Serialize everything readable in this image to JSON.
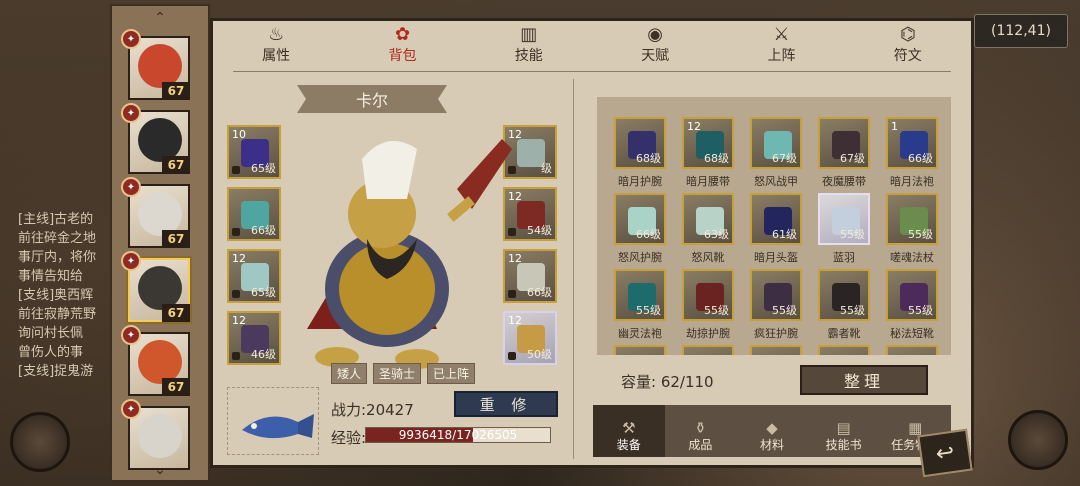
{
  "coordinates": "(112,41)",
  "quest_log": {
    "entries": [
      "[主线]古老的",
      "前往碎金之地",
      "事厅内，将你",
      "事情告知给",
      "[支线]奥西辉",
      "前往寂静荒野",
      "询问村长佩",
      "曾伤人的事",
      "[支线]捉鬼游"
    ]
  },
  "roster": {
    "up_arrow": "⌃",
    "down_arrow": "⌄",
    "heroes": [
      {
        "level": "67",
        "face": "#c9472d",
        "selected": false
      },
      {
        "level": "67",
        "face": "#2a2a2a",
        "selected": false
      },
      {
        "level": "67",
        "face": "#dcd7cf",
        "selected": false
      },
      {
        "level": "67",
        "face": "#3b3733",
        "selected": true
      },
      {
        "level": "67",
        "face": "#d0562b",
        "selected": false
      },
      {
        "level": "",
        "face": "#d8d4cc",
        "selected": false
      }
    ]
  },
  "tabs": [
    {
      "label": "属性",
      "icon": "flame-icon",
      "glyph": "♨",
      "active": false
    },
    {
      "label": "背包",
      "icon": "backpack-icon",
      "glyph": "✿",
      "active": true
    },
    {
      "label": "技能",
      "icon": "book-icon",
      "glyph": "▥",
      "active": false
    },
    {
      "label": "天赋",
      "icon": "eye-icon",
      "glyph": "◉",
      "active": false
    },
    {
      "label": "上阵",
      "icon": "crossed-swords-icon",
      "glyph": "⚔",
      "active": false
    },
    {
      "label": "符文",
      "icon": "rune-icon",
      "glyph": "⌬",
      "active": false
    }
  ],
  "hero": {
    "name": "卡尔",
    "tags": [
      "矮人",
      "圣骑士",
      "已上阵"
    ],
    "power_label": "战力:20427",
    "repair_label": "重 修",
    "exp_label": "经验:",
    "exp_text": "9936418/17026505",
    "exp_fraction": 0.584
  },
  "equipped_left": [
    {
      "count": "10",
      "level": "65级",
      "color": "#3b2f8a",
      "white": false
    },
    {
      "count": "",
      "level": "66级",
      "color": "#4fa6a0",
      "white": false
    },
    {
      "count": "12",
      "level": "65级",
      "color": "#9fc7c3",
      "white": false
    },
    {
      "count": "12",
      "level": "46级",
      "color": "#4b3a5e",
      "white": false
    }
  ],
  "equipped_right": [
    {
      "count": "12",
      "level": "级",
      "color": "#9db0a9",
      "white": false
    },
    {
      "count": "12",
      "level": "54级",
      "color": "#7d2a24",
      "white": false
    },
    {
      "count": "12",
      "level": "66级",
      "color": "#c8c6b6",
      "white": false
    },
    {
      "count": "12",
      "level": "50级",
      "color": "#c79a45",
      "white": true
    }
  ],
  "inventory": [
    {
      "name": "暗月护腕",
      "level": "68级",
      "count": "",
      "color": "#33306b",
      "white": false
    },
    {
      "name": "暗月腰带",
      "level": "68级",
      "count": "12",
      "color": "#1f5f64",
      "white": false
    },
    {
      "name": "怒风战甲",
      "level": "67级",
      "count": "",
      "color": "#6fb8b1",
      "white": false
    },
    {
      "name": "夜魔腰带",
      "level": "67级",
      "count": "",
      "color": "#3d2f33",
      "white": false
    },
    {
      "name": "暗月法袍",
      "level": "66级",
      "count": "1",
      "color": "#2b3b8c",
      "white": false
    },
    {
      "name": "怒风护腕",
      "level": "66级",
      "count": "",
      "color": "#a9d3c6",
      "white": false
    },
    {
      "name": "怒风靴",
      "level": "63级",
      "count": "",
      "color": "#b8d2c8",
      "white": false
    },
    {
      "name": "暗月头盔",
      "level": "61级",
      "count": "",
      "color": "#23265e",
      "white": false
    },
    {
      "name": "蓝羽",
      "level": "55级",
      "count": "",
      "color": "#c3cfdc",
      "white": true
    },
    {
      "name": "嗟魂法杖",
      "level": "55级",
      "count": "",
      "color": "#6a8c4c",
      "white": false
    },
    {
      "name": "幽灵法袍",
      "level": "55级",
      "count": "",
      "color": "#1d6b6a",
      "white": false
    },
    {
      "name": "劫掠护腕",
      "level": "55级",
      "count": "",
      "color": "#6b2322",
      "white": false
    },
    {
      "name": "疯狂护腕",
      "level": "55级",
      "count": "",
      "color": "#3e2e44",
      "white": false
    },
    {
      "name": "霸者靴",
      "level": "55级",
      "count": "",
      "color": "#2a2424",
      "white": false
    },
    {
      "name": "秘法短靴",
      "level": "55级",
      "count": "",
      "color": "#4c2b5b",
      "white": false
    },
    {
      "name": "",
      "level": "",
      "count": "",
      "color": "#6d2a25",
      "white": false
    },
    {
      "name": "",
      "level": "",
      "count": "",
      "color": "#6b2a2a",
      "white": false
    },
    {
      "name": "",
      "level": "",
      "count": "",
      "color": "#3a3540",
      "white": false
    },
    {
      "name": "",
      "level": "",
      "count": "",
      "color": "#5a4a3c",
      "white": false
    },
    {
      "name": "",
      "level": "",
      "count": "",
      "color": "#c9b995",
      "white": false
    }
  ],
  "capacity_label": "容量:  62/110",
  "sort_label": "整理",
  "categories": [
    {
      "label": "装备",
      "icon": "hammer-icon",
      "glyph": "⚒",
      "active": true
    },
    {
      "label": "成品",
      "icon": "potion-icon",
      "glyph": "⚱",
      "active": false
    },
    {
      "label": "材料",
      "icon": "ore-icon",
      "glyph": "◆",
      "active": false
    },
    {
      "label": "技能书",
      "icon": "scroll-icon",
      "glyph": "▤",
      "active": false
    },
    {
      "label": "任务物品",
      "icon": "quest-scroll-icon",
      "glyph": "▦",
      "active": false
    }
  ],
  "back_label": "↩"
}
